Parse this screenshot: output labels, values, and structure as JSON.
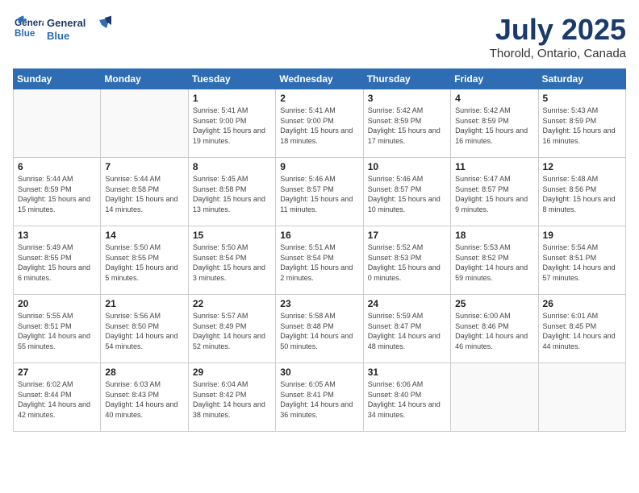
{
  "header": {
    "logo_line1": "General",
    "logo_line2": "Blue",
    "month": "July 2025",
    "location": "Thorold, Ontario, Canada"
  },
  "weekdays": [
    "Sunday",
    "Monday",
    "Tuesday",
    "Wednesday",
    "Thursday",
    "Friday",
    "Saturday"
  ],
  "weeks": [
    [
      {
        "day": "",
        "text": ""
      },
      {
        "day": "",
        "text": ""
      },
      {
        "day": "1",
        "text": "Sunrise: 5:41 AM\nSunset: 9:00 PM\nDaylight: 15 hours and 19 minutes."
      },
      {
        "day": "2",
        "text": "Sunrise: 5:41 AM\nSunset: 9:00 PM\nDaylight: 15 hours and 18 minutes."
      },
      {
        "day": "3",
        "text": "Sunrise: 5:42 AM\nSunset: 8:59 PM\nDaylight: 15 hours and 17 minutes."
      },
      {
        "day": "4",
        "text": "Sunrise: 5:42 AM\nSunset: 8:59 PM\nDaylight: 15 hours and 16 minutes."
      },
      {
        "day": "5",
        "text": "Sunrise: 5:43 AM\nSunset: 8:59 PM\nDaylight: 15 hours and 16 minutes."
      }
    ],
    [
      {
        "day": "6",
        "text": "Sunrise: 5:44 AM\nSunset: 8:59 PM\nDaylight: 15 hours and 15 minutes."
      },
      {
        "day": "7",
        "text": "Sunrise: 5:44 AM\nSunset: 8:58 PM\nDaylight: 15 hours and 14 minutes."
      },
      {
        "day": "8",
        "text": "Sunrise: 5:45 AM\nSunset: 8:58 PM\nDaylight: 15 hours and 13 minutes."
      },
      {
        "day": "9",
        "text": "Sunrise: 5:46 AM\nSunset: 8:57 PM\nDaylight: 15 hours and 11 minutes."
      },
      {
        "day": "10",
        "text": "Sunrise: 5:46 AM\nSunset: 8:57 PM\nDaylight: 15 hours and 10 minutes."
      },
      {
        "day": "11",
        "text": "Sunrise: 5:47 AM\nSunset: 8:57 PM\nDaylight: 15 hours and 9 minutes."
      },
      {
        "day": "12",
        "text": "Sunrise: 5:48 AM\nSunset: 8:56 PM\nDaylight: 15 hours and 8 minutes."
      }
    ],
    [
      {
        "day": "13",
        "text": "Sunrise: 5:49 AM\nSunset: 8:55 PM\nDaylight: 15 hours and 6 minutes."
      },
      {
        "day": "14",
        "text": "Sunrise: 5:50 AM\nSunset: 8:55 PM\nDaylight: 15 hours and 5 minutes."
      },
      {
        "day": "15",
        "text": "Sunrise: 5:50 AM\nSunset: 8:54 PM\nDaylight: 15 hours and 3 minutes."
      },
      {
        "day": "16",
        "text": "Sunrise: 5:51 AM\nSunset: 8:54 PM\nDaylight: 15 hours and 2 minutes."
      },
      {
        "day": "17",
        "text": "Sunrise: 5:52 AM\nSunset: 8:53 PM\nDaylight: 15 hours and 0 minutes."
      },
      {
        "day": "18",
        "text": "Sunrise: 5:53 AM\nSunset: 8:52 PM\nDaylight: 14 hours and 59 minutes."
      },
      {
        "day": "19",
        "text": "Sunrise: 5:54 AM\nSunset: 8:51 PM\nDaylight: 14 hours and 57 minutes."
      }
    ],
    [
      {
        "day": "20",
        "text": "Sunrise: 5:55 AM\nSunset: 8:51 PM\nDaylight: 14 hours and 55 minutes."
      },
      {
        "day": "21",
        "text": "Sunrise: 5:56 AM\nSunset: 8:50 PM\nDaylight: 14 hours and 54 minutes."
      },
      {
        "day": "22",
        "text": "Sunrise: 5:57 AM\nSunset: 8:49 PM\nDaylight: 14 hours and 52 minutes."
      },
      {
        "day": "23",
        "text": "Sunrise: 5:58 AM\nSunset: 8:48 PM\nDaylight: 14 hours and 50 minutes."
      },
      {
        "day": "24",
        "text": "Sunrise: 5:59 AM\nSunset: 8:47 PM\nDaylight: 14 hours and 48 minutes."
      },
      {
        "day": "25",
        "text": "Sunrise: 6:00 AM\nSunset: 8:46 PM\nDaylight: 14 hours and 46 minutes."
      },
      {
        "day": "26",
        "text": "Sunrise: 6:01 AM\nSunset: 8:45 PM\nDaylight: 14 hours and 44 minutes."
      }
    ],
    [
      {
        "day": "27",
        "text": "Sunrise: 6:02 AM\nSunset: 8:44 PM\nDaylight: 14 hours and 42 minutes."
      },
      {
        "day": "28",
        "text": "Sunrise: 6:03 AM\nSunset: 8:43 PM\nDaylight: 14 hours and 40 minutes."
      },
      {
        "day": "29",
        "text": "Sunrise: 6:04 AM\nSunset: 8:42 PM\nDaylight: 14 hours and 38 minutes."
      },
      {
        "day": "30",
        "text": "Sunrise: 6:05 AM\nSunset: 8:41 PM\nDaylight: 14 hours and 36 minutes."
      },
      {
        "day": "31",
        "text": "Sunrise: 6:06 AM\nSunset: 8:40 PM\nDaylight: 14 hours and 34 minutes."
      },
      {
        "day": "",
        "text": ""
      },
      {
        "day": "",
        "text": ""
      }
    ]
  ]
}
